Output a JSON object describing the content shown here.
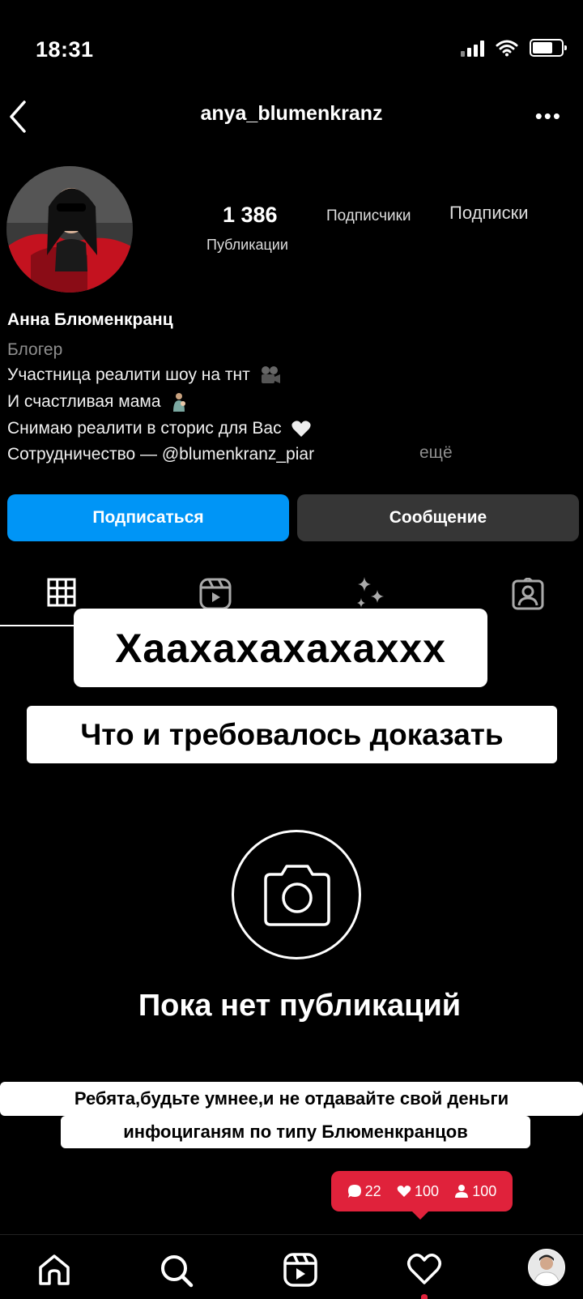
{
  "status_bar": {
    "time": "18:31"
  },
  "header": {
    "username": "anya_blumenkranz"
  },
  "profile": {
    "posts_count": "1 386",
    "posts_label": "Публикации",
    "followers_label": "Подписчики",
    "following_label": "Подписки",
    "name": "Анна Блюменкранц",
    "category": "Блогер",
    "bio": [
      "Участница реалити шоу на тнт",
      "И счастливая мама",
      "Снимаю реалити в сторис для Вас",
      "Сотрудничество — @blumenkranz_piar"
    ],
    "more_label": "ещё"
  },
  "actions": {
    "follow_label": "Подписаться",
    "message_label": "Сообщение"
  },
  "overlay": {
    "caption1": "Хаахахахахаххх",
    "caption2": "Что и требовалось доказать",
    "caption3_line1": "Ребята,будьте умнее,и не отдавайте свой деньги",
    "caption3_line2": "инфоциганям по типу Блюменкранцов"
  },
  "empty_state": {
    "title": "Пока нет публикаций"
  },
  "notifications": {
    "comments": "22",
    "likes": "100",
    "follows": "100"
  },
  "colors": {
    "accent": "#0095f6",
    "notification": "#e0223b",
    "button_secondary": "#363636"
  }
}
